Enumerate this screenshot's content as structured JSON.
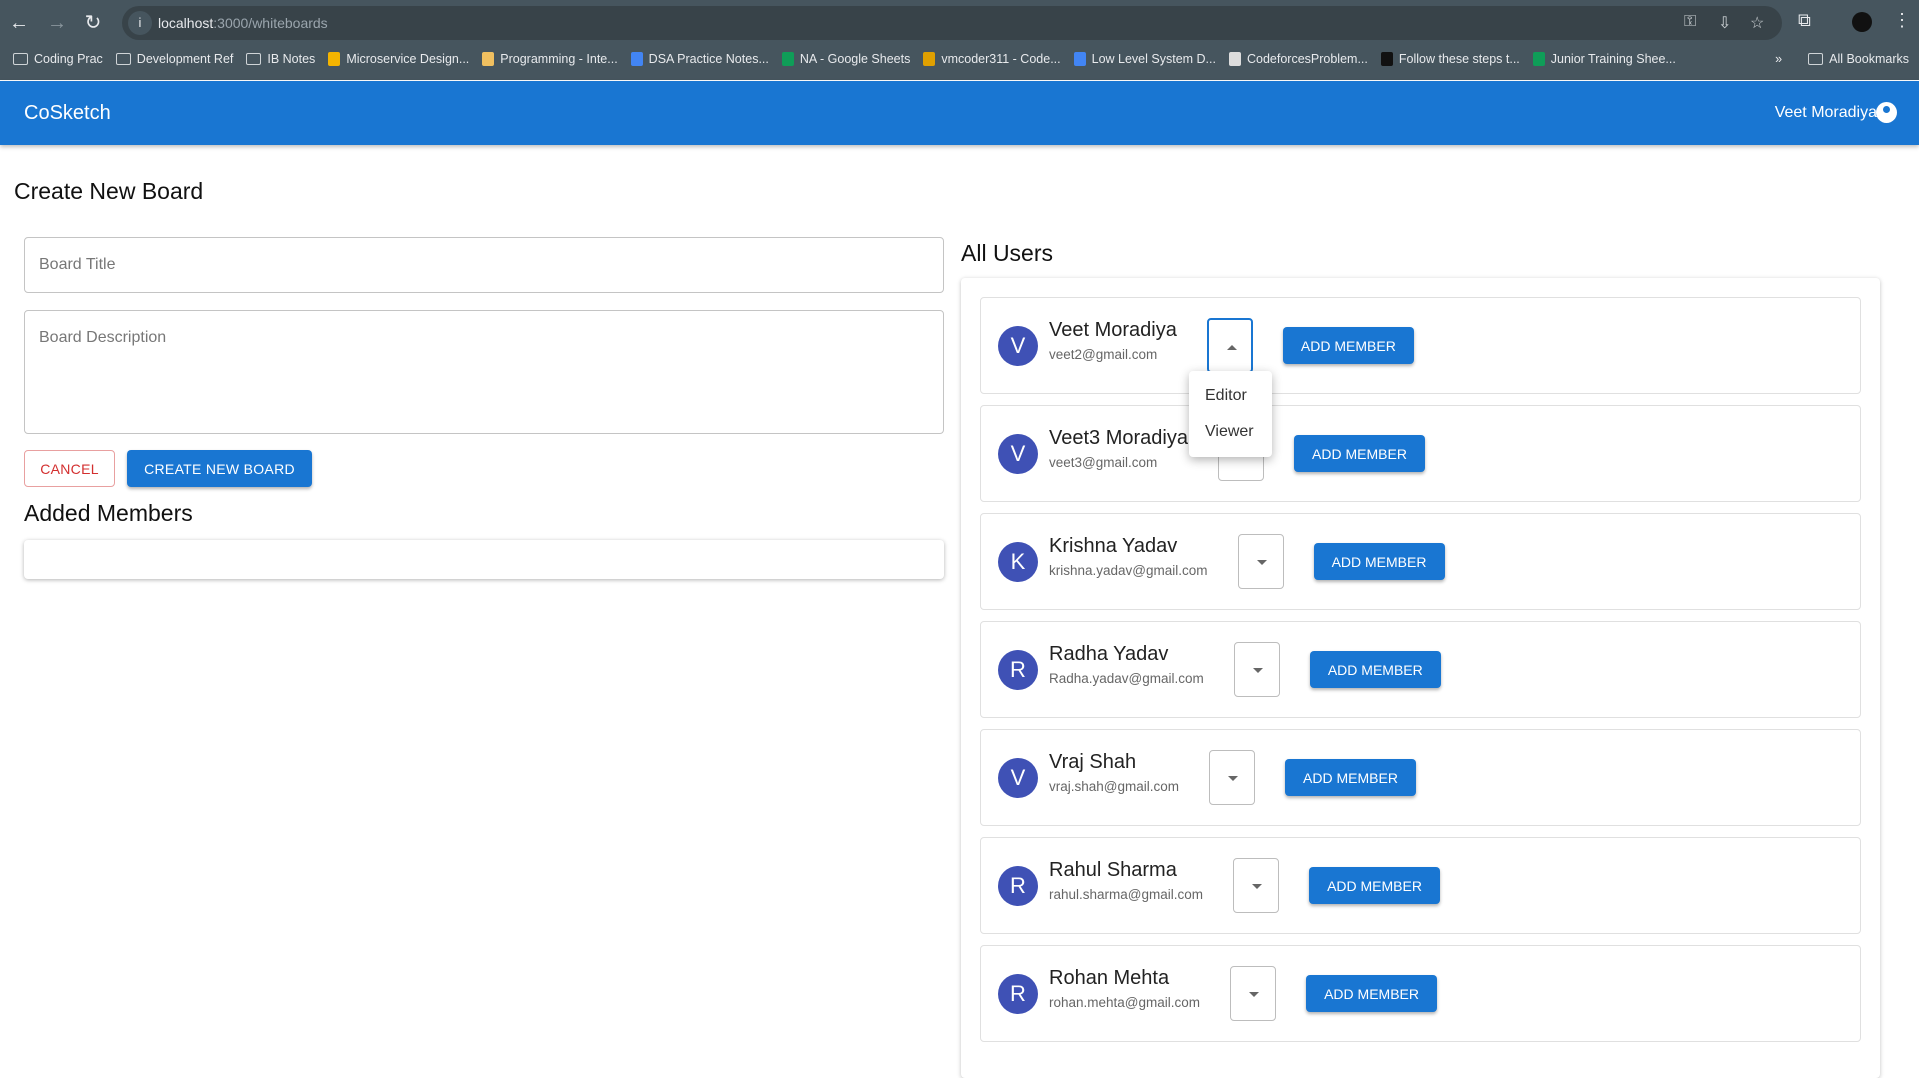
{
  "browser": {
    "url_host": "localhost",
    "url_path": ":3000/whiteboards",
    "bookmarks": [
      {
        "label": "Coding Prac",
        "icon": "folder-icon"
      },
      {
        "label": "Development Ref",
        "icon": "folder-icon"
      },
      {
        "label": "IB Notes",
        "icon": "folder-icon"
      },
      {
        "label": "Microservice Design...",
        "icon": "drive-icon",
        "color": "#f4b400"
      },
      {
        "label": "Programming - Inte...",
        "icon": "site-icon",
        "color": "#f0c060"
      },
      {
        "label": "DSA Practice Notes...",
        "icon": "docs-icon",
        "color": "#4285f4"
      },
      {
        "label": "NA - Google Sheets",
        "icon": "sheets-icon",
        "color": "#0f9d58"
      },
      {
        "label": "vmcoder311 - Code...",
        "icon": "chart-icon",
        "color": "#e0a000"
      },
      {
        "label": "Low Level System D...",
        "icon": "docs-icon",
        "color": "#4285f4"
      },
      {
        "label": "CodeforcesProblem...",
        "icon": "globe-icon",
        "color": "#ddd"
      },
      {
        "label": "Follow these steps t...",
        "icon": "site-icon",
        "color": "#111"
      },
      {
        "label": "Junior Training Shee...",
        "icon": "sheets-icon",
        "color": "#0f9d58"
      }
    ],
    "all_bookmarks": "All Bookmarks"
  },
  "app": {
    "brand": "CoSketch",
    "user": "Veet Moradiya"
  },
  "form": {
    "heading": "Create New Board",
    "title_placeholder": "Board Title",
    "description_placeholder": "Board Description",
    "cancel": "CANCEL",
    "create": "CREATE NEW BOARD",
    "added_members": "Added Members"
  },
  "users_heading": "All Users",
  "add_label": "ADD MEMBER",
  "users": [
    {
      "initial": "V",
      "name": "Veet Moradiya",
      "email": "veet2@gmail.com",
      "open": true
    },
    {
      "initial": "V",
      "name": "Veet3 Moradiya",
      "email": "veet3@gmail.com"
    },
    {
      "initial": "K",
      "name": "Krishna Yadav",
      "email": "krishna.yadav@gmail.com"
    },
    {
      "initial": "R",
      "name": "Radha Yadav",
      "email": "Radha.yadav@gmail.com"
    },
    {
      "initial": "V",
      "name": "Vraj Shah",
      "email": "vraj.shah@gmail.com"
    },
    {
      "initial": "R",
      "name": "Rahul Sharma",
      "email": "rahul.sharma@gmail.com"
    },
    {
      "initial": "R",
      "name": "Rohan Mehta",
      "email": "rohan.mehta@gmail.com"
    }
  ],
  "role_menu": [
    "Editor",
    "Viewer"
  ]
}
